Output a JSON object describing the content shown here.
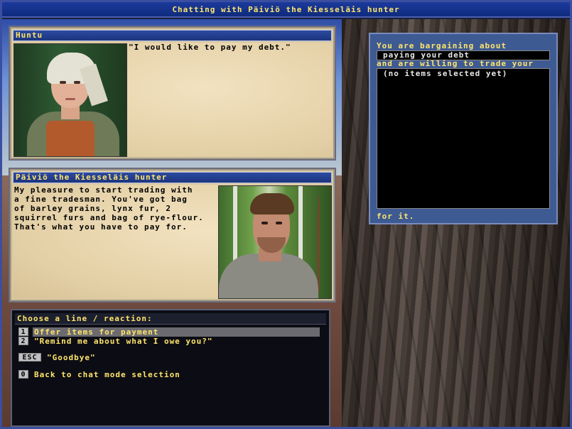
{
  "window": {
    "title": "Chatting with Päiviö the Kiesseläis hunter"
  },
  "player_panel": {
    "name": "Huntu",
    "speech": "\"I would like to pay my debt.\""
  },
  "npc_panel": {
    "name": "Päiviö the Kiesseläis hunter",
    "speech": "My pleasure to start trading with\na fine tradesman. You've got bag\nof barley grains, lynx fur, 2\nsquirrel furs and bag of rye-flour.\nThat's what you have to pay for."
  },
  "choices": {
    "header": "Choose a line / reaction:",
    "items": [
      {
        "key": "1",
        "text": "Offer items for payment",
        "selected": true
      },
      {
        "key": "2",
        "text": "\"Remind me about what I owe you?\"",
        "selected": false
      },
      {
        "key": "ESC",
        "text": "\"Goodbye\"",
        "selected": false
      },
      {
        "key": "0",
        "text": "Back to chat mode selection",
        "selected": false
      }
    ]
  },
  "bargain": {
    "label_top": "You are bargaining about",
    "subject": "paying your debt",
    "label_mid": "and are willing to trade your",
    "items_placeholder": "(no items selected yet)",
    "label_bottom": "for it."
  },
  "colors": {
    "title_text": "#ffe56b",
    "header_blue": "#1c357f",
    "parchment": "#e3cfa5",
    "bargain_panel": "#3e5a93"
  },
  "icons": {
    "player_portrait": "woman-portrait",
    "npc_portrait": "hunter-portrait"
  }
}
